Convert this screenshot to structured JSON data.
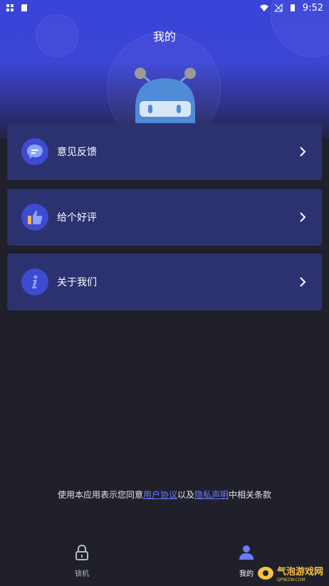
{
  "status_bar": {
    "time": "9:52"
  },
  "header": {
    "title": "我的"
  },
  "menu": [
    {
      "label": "意见反馈",
      "icon": "feedback-chat-icon"
    },
    {
      "label": "给个好评",
      "icon": "thumbs-up-icon"
    },
    {
      "label": "关于我们",
      "icon": "info-icon"
    }
  ],
  "agreement": {
    "prefix": "使用本应用表示您同意",
    "user_agreement": "用户协议",
    "conjunction": "以及",
    "privacy": "隐私声明",
    "suffix": "中相关条款"
  },
  "tabbar": {
    "lock_label": "锁机",
    "me_label": "我的"
  },
  "watermark": {
    "text": "气泡游戏网",
    "subtext": "QPWZW.COM"
  },
  "colors": {
    "accent": "#3d4bcf",
    "card": "#2c3170",
    "background": "#1f2029",
    "link": "#6a7bff"
  }
}
